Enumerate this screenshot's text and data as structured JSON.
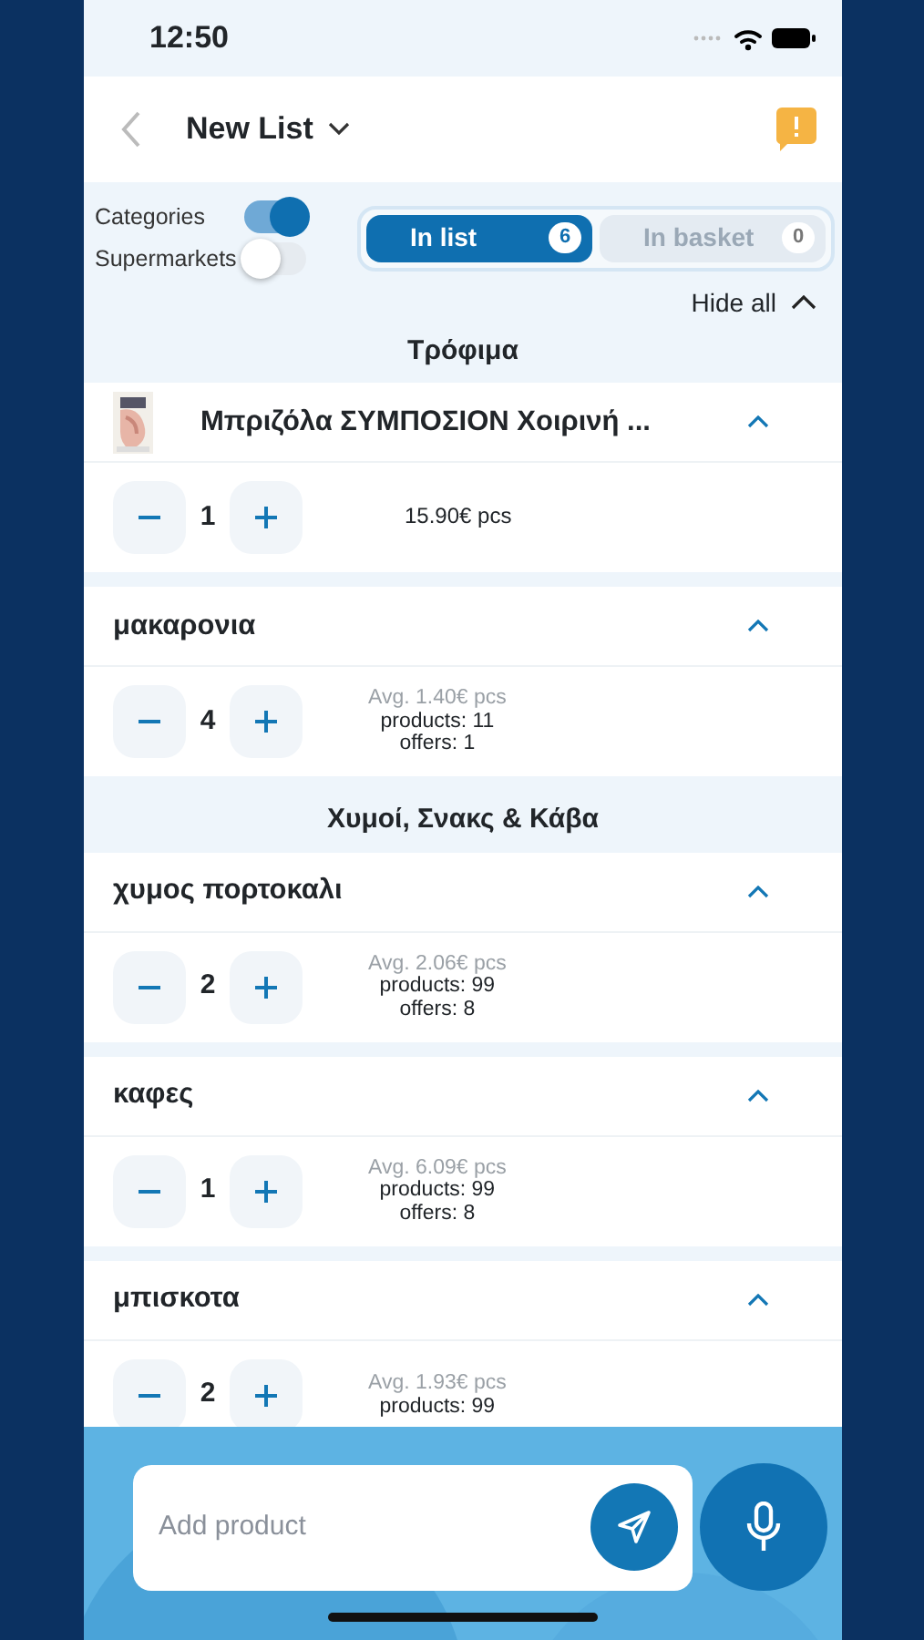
{
  "status_bar": {
    "time": "12:50"
  },
  "header": {
    "title": "New List"
  },
  "filters": [
    {
      "label": "Categories",
      "on": true
    },
    {
      "label": "Supermarkets",
      "on": false
    }
  ],
  "tabs": [
    {
      "label": "In list",
      "count": "6",
      "selected": true
    },
    {
      "label": "In basket",
      "count": "0",
      "selected": false
    }
  ],
  "hide_all": "Hide all",
  "sections": [
    {
      "title": "Τρόφιμα",
      "items": [
        {
          "kind": "product",
          "name": "Μπριζόλα ΣΥΜΠΟΣΙΟΝ Χοιρινή ...",
          "quantity": "1",
          "price": "15.90€ pcs",
          "expanded": true
        },
        {
          "kind": "generic",
          "name": "μακαρονια",
          "quantity": "4",
          "avg": "Avg. 1.40€ pcs",
          "products": "products: 11",
          "offers": "offers: 1",
          "expanded": true
        }
      ]
    },
    {
      "title": "Χυμοί, Σνακς & Κάβα",
      "items": [
        {
          "kind": "generic",
          "name": "χυμος πορτοκαλι",
          "quantity": "2",
          "avg": "Avg. 2.06€ pcs",
          "products": "products: 99",
          "offers": "offers: 8",
          "expanded": true
        },
        {
          "kind": "generic",
          "name": "καφες",
          "quantity": "1",
          "avg": "Avg. 6.09€ pcs",
          "products": "products: 99",
          "offers": "offers: 8",
          "expanded": true
        },
        {
          "kind": "generic",
          "name": "μπισκοτα",
          "quantity": "2",
          "avg": "Avg. 1.93€ pcs",
          "products": "products: 99",
          "expanded": true
        }
      ]
    }
  ],
  "add_field": {
    "placeholder": "Add product"
  }
}
